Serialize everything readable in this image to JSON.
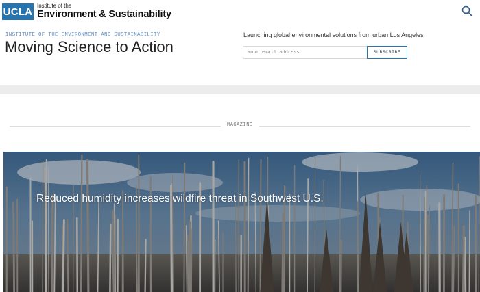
{
  "header": {
    "logo_mark": "UCLA",
    "logo_line1": "Institute of the",
    "logo_line2": "Environment & Sustainability",
    "search_icon": "search-icon"
  },
  "intro": {
    "eyebrow": "INSTITUTE OF THE ENVIRONMENT AND SUSTAINABILITY",
    "title": "Moving Science to Action"
  },
  "newsletter": {
    "tagline": "Launching global environmental solutions from urban Los Angeles",
    "email_placeholder": "Your email address",
    "email_value": "",
    "subscribe_label": "SUBSCRIBE"
  },
  "section": {
    "label": "MAGAZINE"
  },
  "feature": {
    "headline": "Reduced humidity increases wildfire threat in Southwest U.S.",
    "image_subject": "burned forest of dead standing trees under a partly cloudy blue sky"
  },
  "colors": {
    "brand_blue": "#2774ae",
    "eyebrow_blue": "#5b8fc4",
    "band_gray": "#ececec"
  }
}
